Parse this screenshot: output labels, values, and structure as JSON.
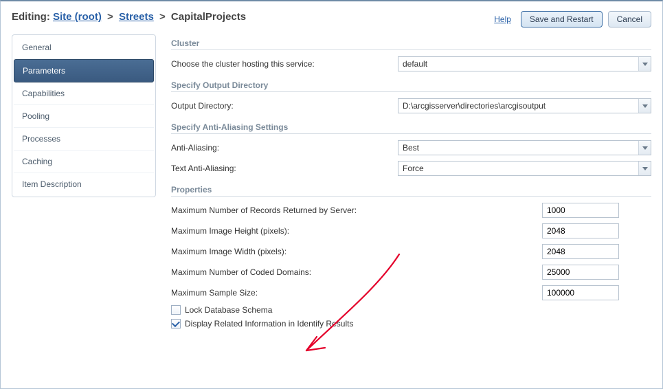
{
  "header": {
    "editing_prefix": "Editing:",
    "crumb_site": "Site (root)",
    "crumb_streets": "Streets",
    "crumb_current": "CapitalProjects",
    "help": "Help",
    "save": "Save and Restart",
    "cancel": "Cancel"
  },
  "sidebar": {
    "items": [
      {
        "label": "General",
        "selected": false
      },
      {
        "label": "Parameters",
        "selected": true
      },
      {
        "label": "Capabilities",
        "selected": false
      },
      {
        "label": "Pooling",
        "selected": false
      },
      {
        "label": "Processes",
        "selected": false
      },
      {
        "label": "Caching",
        "selected": false
      },
      {
        "label": "Item Description",
        "selected": false
      }
    ]
  },
  "sections": {
    "cluster": {
      "title": "Cluster",
      "choose_label": "Choose the cluster hosting this service:",
      "value": "default"
    },
    "output_dir": {
      "title": "Specify Output Directory",
      "label": "Output Directory:",
      "value": "D:\\arcgisserver\\directories\\arcgisoutput"
    },
    "aa": {
      "title": "Specify Anti-Aliasing Settings",
      "aa_label": "Anti-Aliasing:",
      "aa_value": "Best",
      "text_aa_label": "Text Anti-Aliasing:",
      "text_aa_value": "Force"
    },
    "props": {
      "title": "Properties",
      "max_records_label": "Maximum Number of Records Returned by Server:",
      "max_records_value": "1000",
      "max_img_h_label": "Maximum Image Height (pixels):",
      "max_img_h_value": "2048",
      "max_img_w_label": "Maximum Image Width (pixels):",
      "max_img_w_value": "2048",
      "max_coded_label": "Maximum Number of Coded Domains:",
      "max_coded_value": "25000",
      "max_sample_label": "Maximum Sample Size:",
      "max_sample_value": "100000",
      "lock_schema_label": "Lock Database Schema",
      "lock_schema_checked": false,
      "display_related_label": "Display Related Information in Identify Results",
      "display_related_checked": true
    }
  }
}
